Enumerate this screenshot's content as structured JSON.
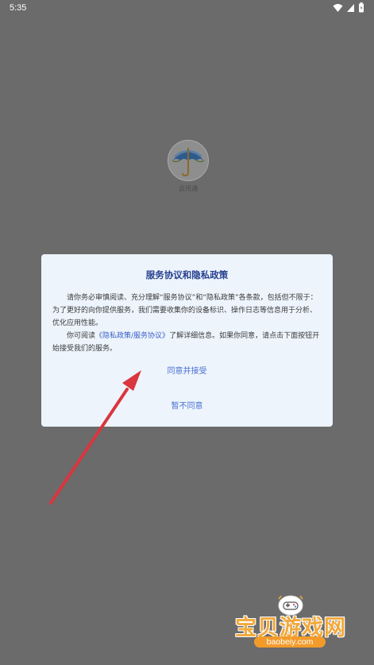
{
  "status_bar": {
    "time": "5:35"
  },
  "app": {
    "name": "云讯通"
  },
  "dialog": {
    "title": "服务协议和隐私政策",
    "paragraph1": "请你务必审慎阅读、充分理解“服务协议”和“隐私政策”各条款，包括但不限于：为了更好的向你提供服务，我们需要收集你的设备标识、操作日志等信息用于分析、优化应用性能。",
    "paragraph2_before": "你可阅读",
    "policy_link": "《隐私政策/服务协议》",
    "paragraph2_after": "了解详细信息。如果你同意，请点击下面按钮开始接受我们的服务。",
    "accept_button": "同意并接受",
    "decline_button": "暂不同意"
  },
  "watermark": {
    "title": "宝贝游戏网",
    "url": "baobeiy.com"
  },
  "colors": {
    "overlay": "#6b6b6b",
    "dialog_bg": "#edf4fc",
    "title": "#26408f",
    "button": "#4a6fd1",
    "arrow": "#d9363e"
  },
  "icons": [
    "wifi-icon",
    "signal-icon",
    "battery-icon",
    "umbrella-icon",
    "arrow-annotation"
  ]
}
